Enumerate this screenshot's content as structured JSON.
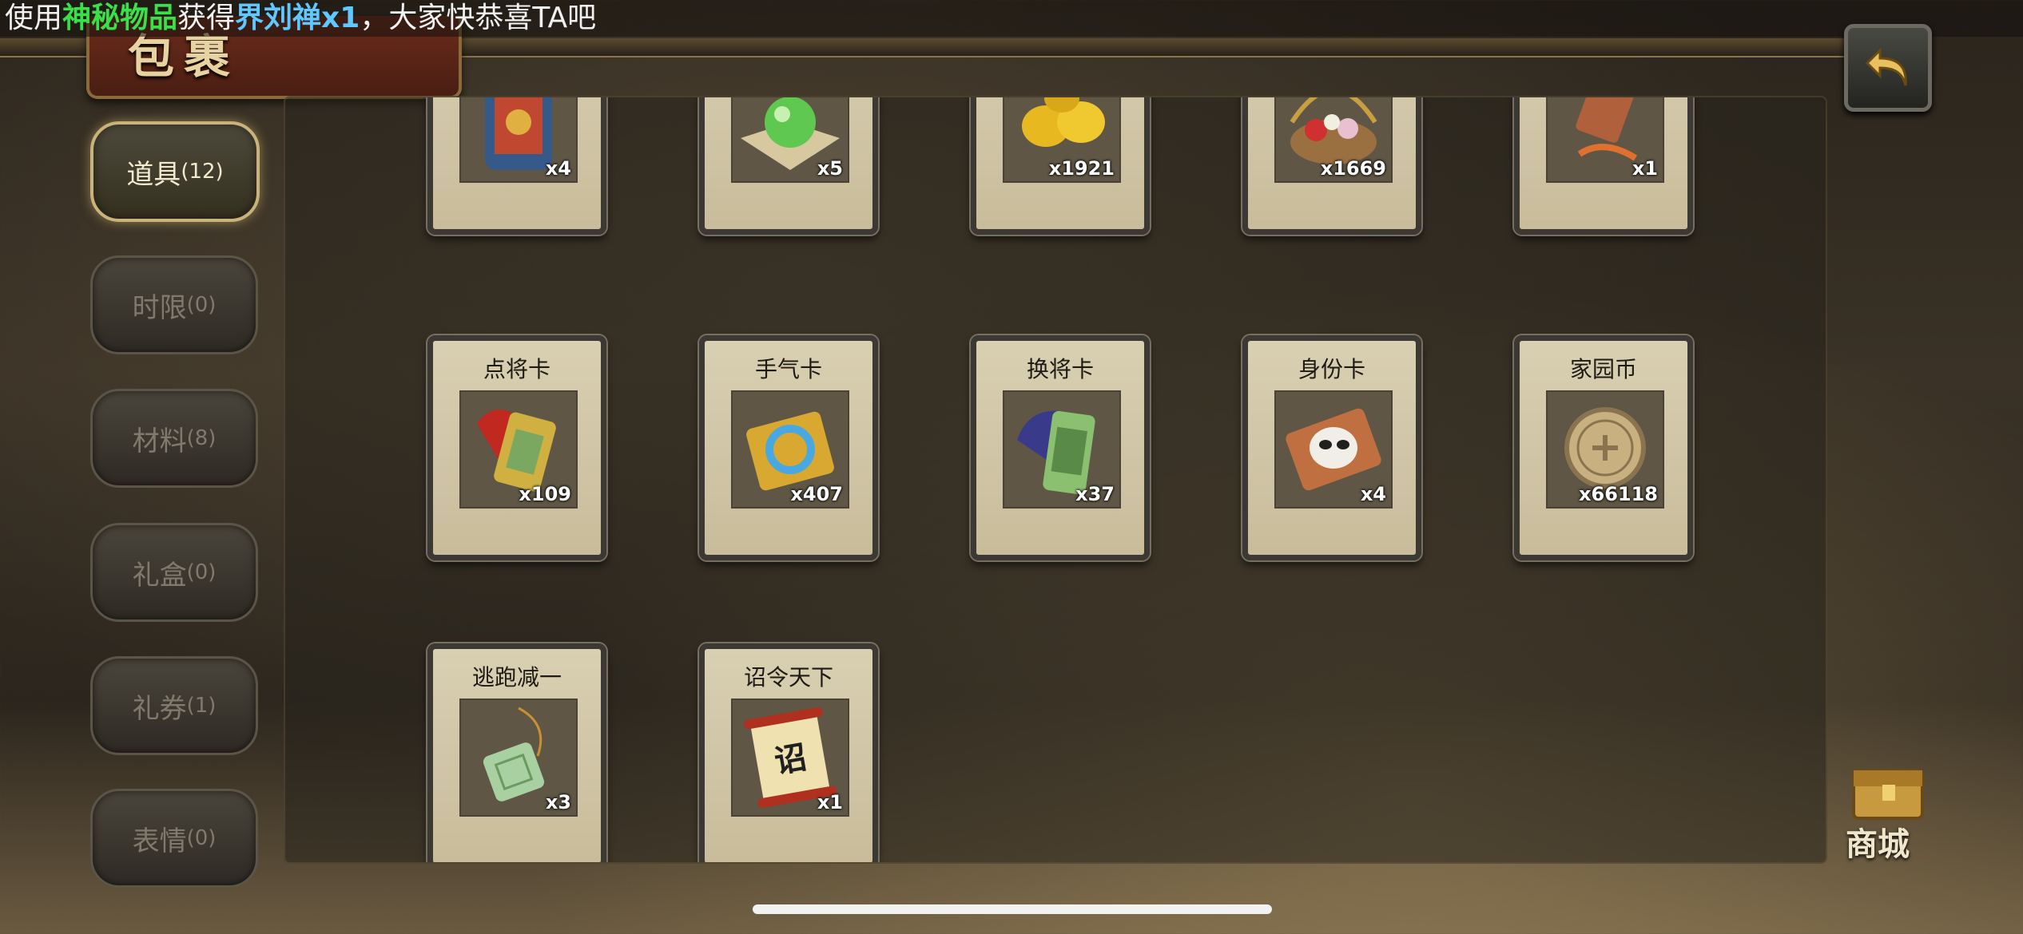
{
  "broadcast": {
    "prefix": "使用",
    "item_source": "神秘物品",
    "middle": "获得",
    "reward": "界刘禅x1",
    "suffix": "，大家快恭喜TA吧",
    "source_color": "#39e04a",
    "reward_color": "#5fc8ff"
  },
  "page": {
    "title": "包裹"
  },
  "tabs": [
    {
      "label": "道具",
      "count": "(12)",
      "active": true
    },
    {
      "label": "时限",
      "count": "(0)",
      "active": false
    },
    {
      "label": "材料",
      "count": "(8)",
      "active": false
    },
    {
      "label": "礼盒",
      "count": "(0)",
      "active": false
    },
    {
      "label": "礼券",
      "count": "(1)",
      "active": false
    },
    {
      "label": "表情",
      "count": "(0)",
      "active": false
    }
  ],
  "items_row1": [
    {
      "name": "",
      "qty": "x4",
      "icon": "armor-icon"
    },
    {
      "name": "",
      "qty": "x5",
      "icon": "jade-orb-icon"
    },
    {
      "name": "",
      "qty": "x1921",
      "icon": "gold-ingot-icon"
    },
    {
      "name": "",
      "qty": "x1669",
      "icon": "flower-basket-icon"
    },
    {
      "name": "",
      "qty": "x1",
      "icon": "token-tag-icon"
    }
  ],
  "items_row2": [
    {
      "name": "点将卡",
      "qty": "x109",
      "icon": "general-pick-card-icon"
    },
    {
      "name": "手气卡",
      "qty": "x407",
      "icon": "luck-card-icon"
    },
    {
      "name": "换将卡",
      "qty": "x37",
      "icon": "swap-general-card-icon"
    },
    {
      "name": "身份卡",
      "qty": "x4",
      "icon": "identity-card-icon"
    },
    {
      "name": "家园币",
      "qty": "x66118",
      "icon": "home-coin-icon"
    }
  ],
  "items_row3": [
    {
      "name": "逃跑减一",
      "qty": "x3",
      "icon": "jade-pendant-icon"
    },
    {
      "name": "诏令天下",
      "qty": "x1",
      "icon": "edict-scroll-icon",
      "glyph": "诏"
    }
  ],
  "shop": {
    "label": "商城"
  }
}
